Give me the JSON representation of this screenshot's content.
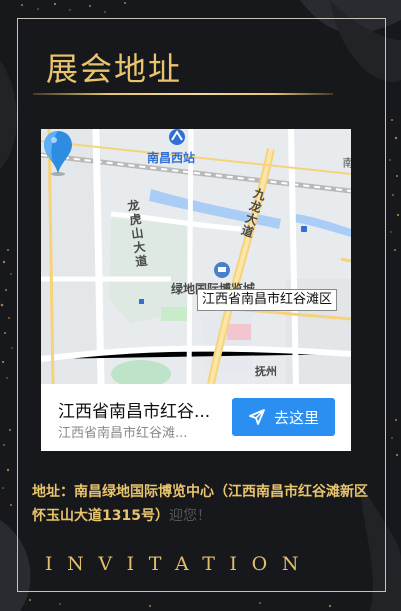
{
  "page": {
    "title": "展会地址",
    "footer": "INVITATION"
  },
  "map": {
    "labels": {
      "station": "南昌西站",
      "road_longhu": "龙虎山大道",
      "road_jiulong": "九龙大道",
      "poi": "绿地国际博览城",
      "road_fuzhou": "抚州",
      "edge": "南"
    },
    "tooltip": "江西省南昌市红谷滩区"
  },
  "location_card": {
    "name": "江西省南昌市红谷...",
    "address": "江西省南昌市红谷滩...",
    "nav_button": "去这里"
  },
  "address": {
    "text": "地址：南昌绿地国际博览中心（江西南昌市红谷滩新区怀玉山大道1315号）",
    "ghost_suffix": "迎您！"
  },
  "colors": {
    "gold": "#e8c46c",
    "button_blue": "#2b8ef1",
    "background": "#17181c"
  },
  "icons": {
    "station": "metro-station-icon",
    "pin": "map-pin-icon",
    "nav": "send-arrow-icon"
  }
}
